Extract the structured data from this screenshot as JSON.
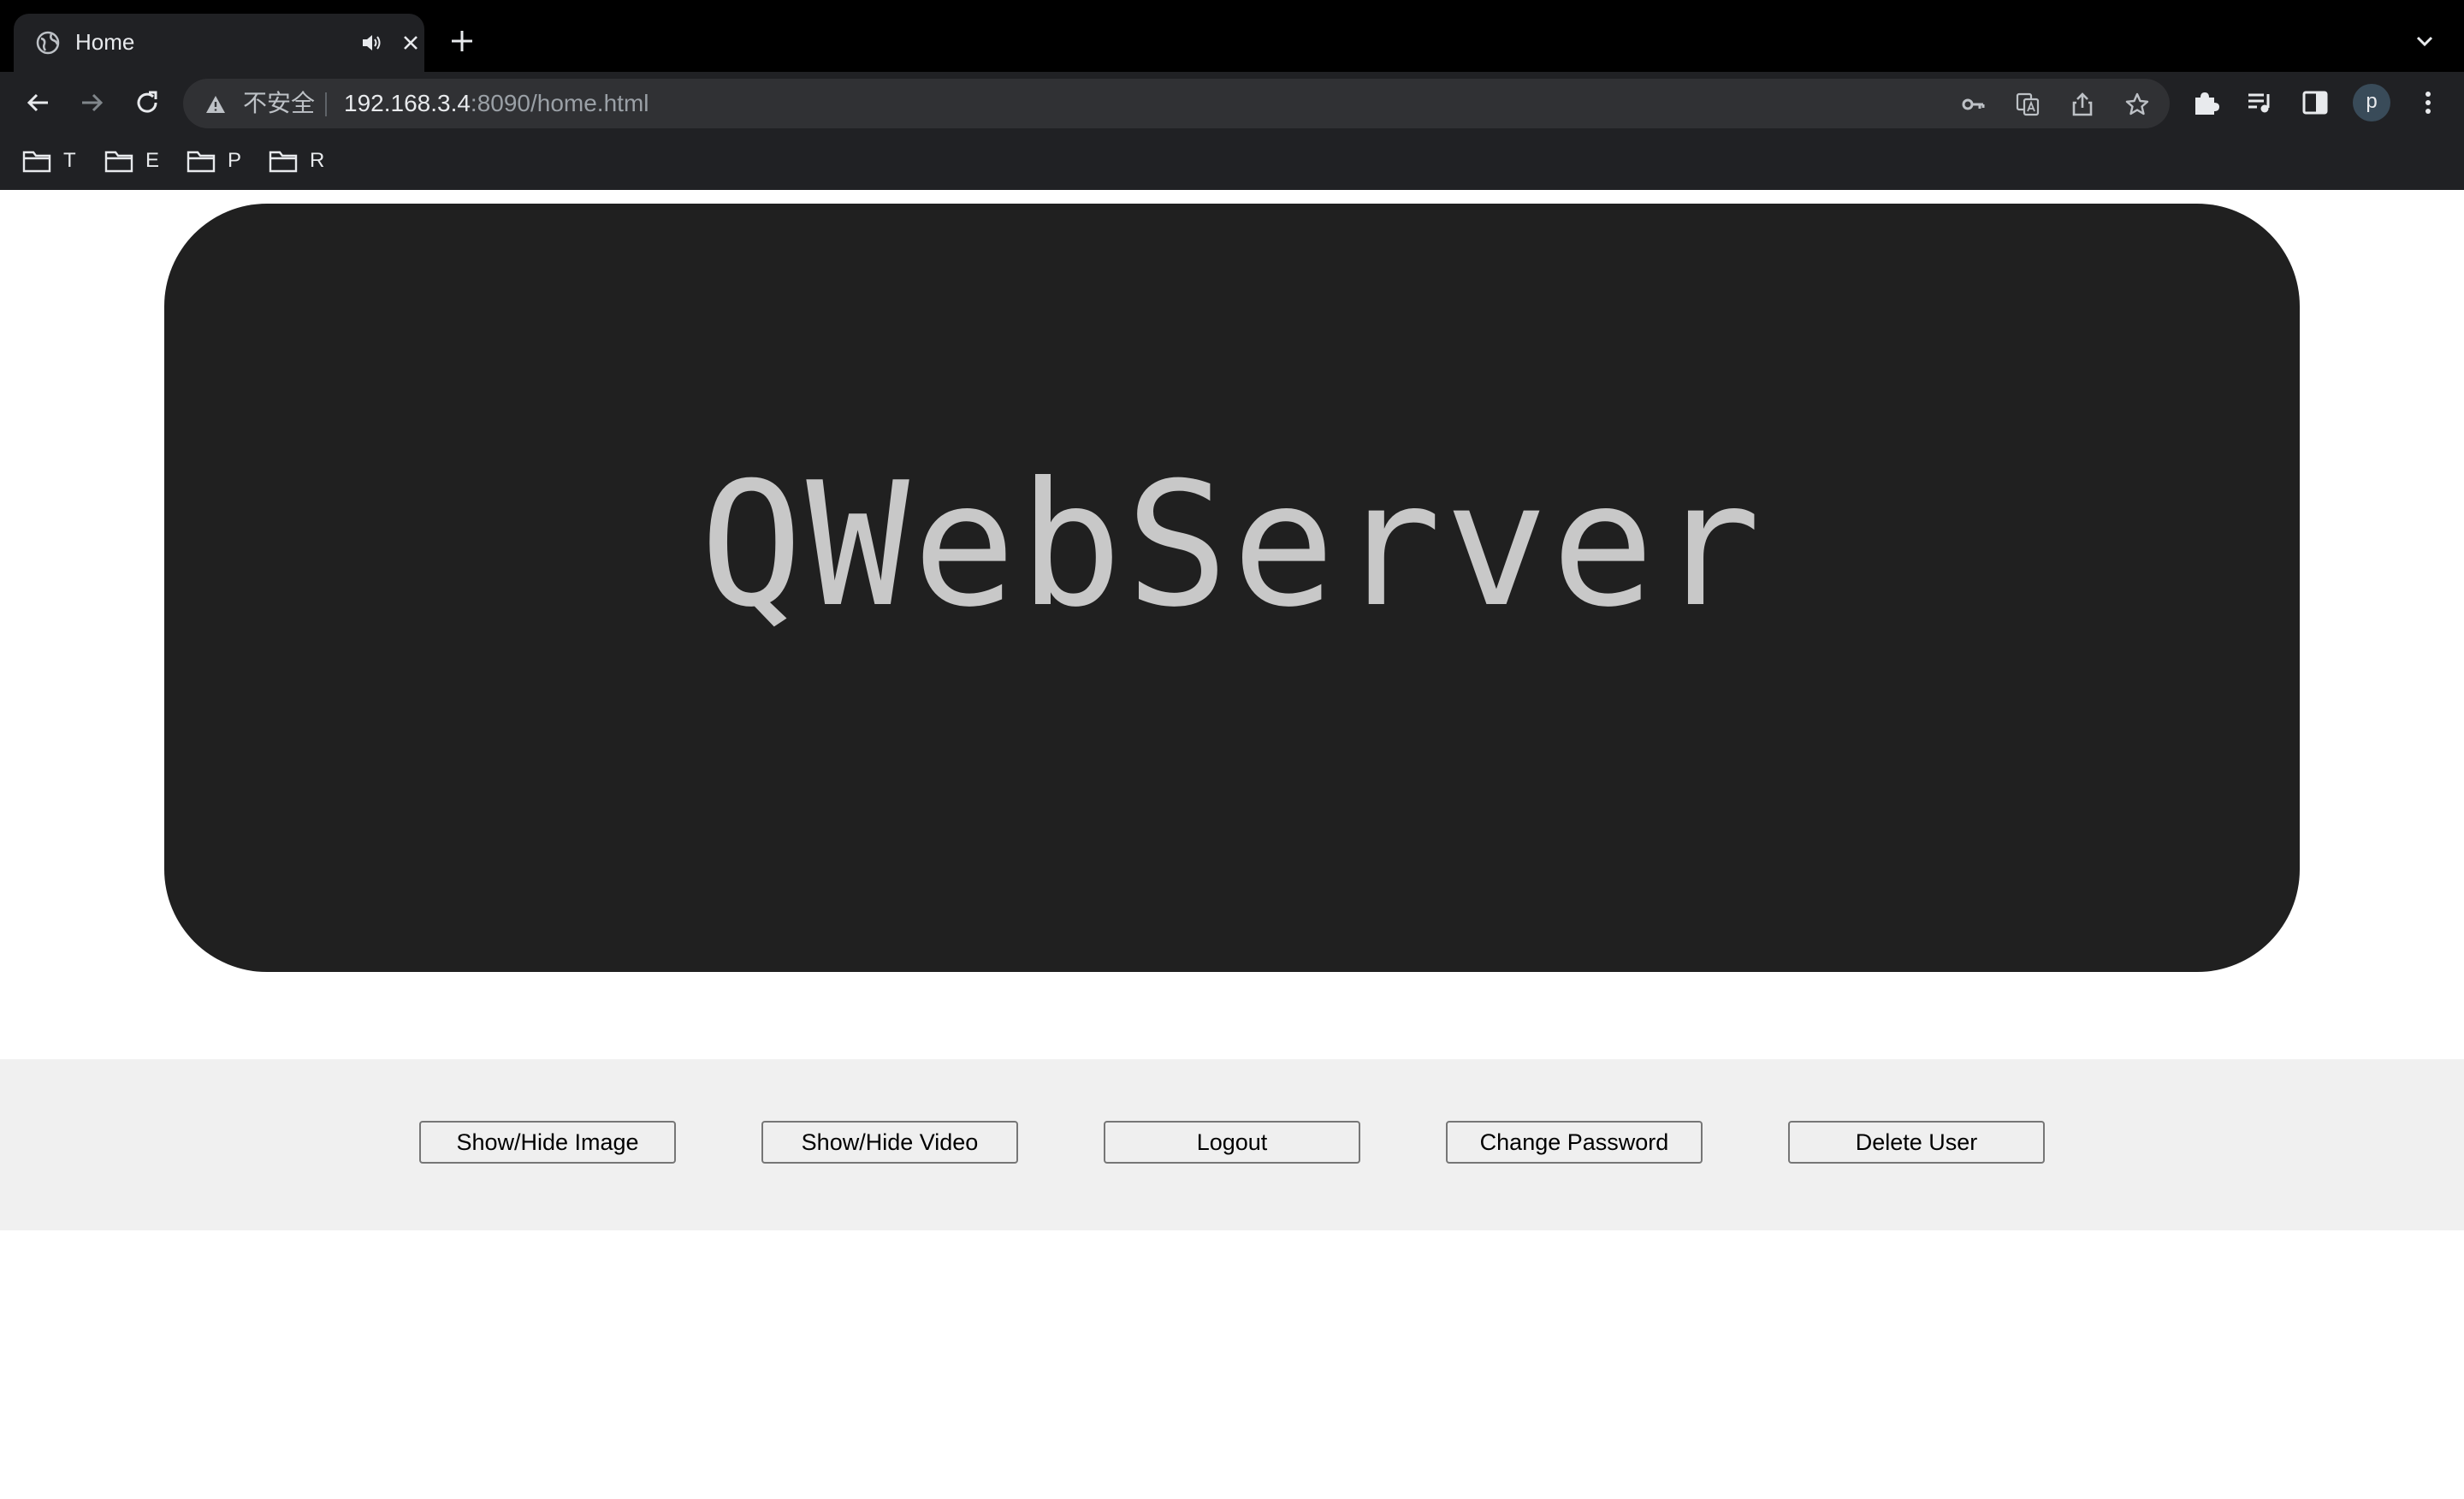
{
  "browser": {
    "tab": {
      "title": "Home",
      "favicon": "globe-icon",
      "audio_icon": "speaker-icon",
      "close_icon": "close-icon"
    },
    "new_tab_icon": "plus-icon",
    "tab_search_icon": "chevron-down-icon",
    "address_bar": {
      "security_label": "不安全",
      "url_host": "192.168.3.4",
      "url_rest": ":8090/home.html"
    },
    "toolbar_icons": [
      "back-icon",
      "forward-icon",
      "reload-icon",
      "key-icon",
      "translate-icon",
      "share-icon",
      "star-icon",
      "extensions-icon",
      "media-icon",
      "side-panel-icon",
      "menu-icon"
    ],
    "profile_initial": "p",
    "bookmarks": [
      {
        "label": "T",
        "icon": "folder-icon"
      },
      {
        "label": "E",
        "icon": "folder-icon"
      },
      {
        "label": "P",
        "icon": "folder-icon"
      },
      {
        "label": "R",
        "icon": "folder-icon"
      }
    ]
  },
  "page": {
    "hero_title": "QWebServer",
    "buttons": {
      "show_hide_image": "Show/Hide Image",
      "show_hide_video": "Show/Hide Video",
      "logout": "Logout",
      "change_password": "Change Password",
      "delete_user": "Delete User"
    }
  },
  "colors": {
    "hero_background": "#202020",
    "hero_text": "#c8c8c8",
    "button_bar_background": "#f0f0f0"
  }
}
